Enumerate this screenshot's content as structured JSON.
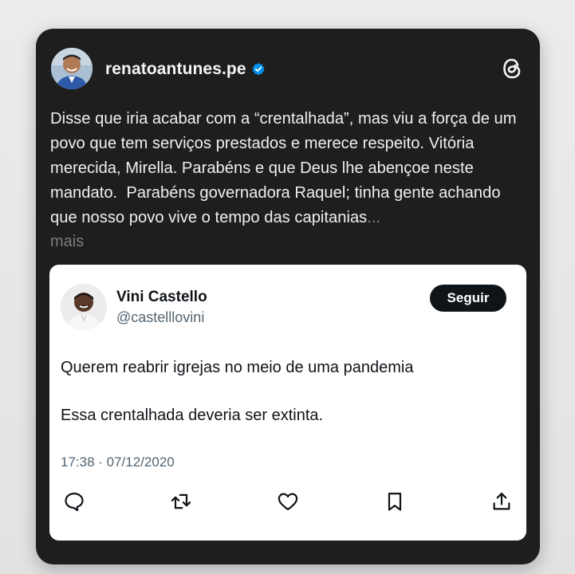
{
  "post": {
    "username": "renatoantunes.pe",
    "text": "Disse que iria acabar com a “crentalhada”, mas viu a força de um povo que tem serviços prestados e merece respeito. Vitória merecida, Mirella. Parabéns e que Deus lhe abençoe neste mandato.  Parabéns governadora Raquel; tinha gente achando que nosso povo vive o tempo das capitanias",
    "ellipsis": "...",
    "more_label": "mais"
  },
  "embed": {
    "name": "Vini Castello",
    "handle": "@castelllovini",
    "follow_label": "Seguir",
    "line1": "Querem reabrir igrejas no meio de uma pandemia",
    "line2": "Essa crentalhada deveria ser extinta.",
    "timestamp": "17:38 · 07/12/2020"
  },
  "icons": {
    "verified": "verified-badge-icon",
    "threads": "threads-logo-icon",
    "reply": "reply-icon",
    "retweet": "retweet-icon",
    "like": "heart-icon",
    "bookmark": "bookmark-icon",
    "share": "share-icon"
  },
  "colors": {
    "card_bg": "#1e1e1e",
    "verified_blue": "#0095f6",
    "follow_button": "#0f1419"
  }
}
